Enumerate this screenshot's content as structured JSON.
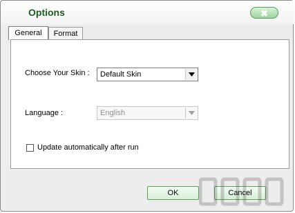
{
  "window": {
    "title": "Options",
    "close_glyph": "✖"
  },
  "tabs": [
    {
      "label": "General",
      "active": true
    },
    {
      "label": "Format",
      "active": false
    }
  ],
  "general": {
    "skin": {
      "label": "Choose Your Skin :",
      "value": "Default Skin"
    },
    "language": {
      "label": "Language :",
      "value": "English",
      "disabled": true
    },
    "auto_update": {
      "label": "Update automatically after run",
      "checked": false
    }
  },
  "footer": {
    "ok_label": "OK",
    "cancel_label": "Cancel"
  },
  "colors": {
    "title": "#1f5a1f",
    "accent_green": "#5aa05a",
    "window_bg": "#ededed"
  }
}
